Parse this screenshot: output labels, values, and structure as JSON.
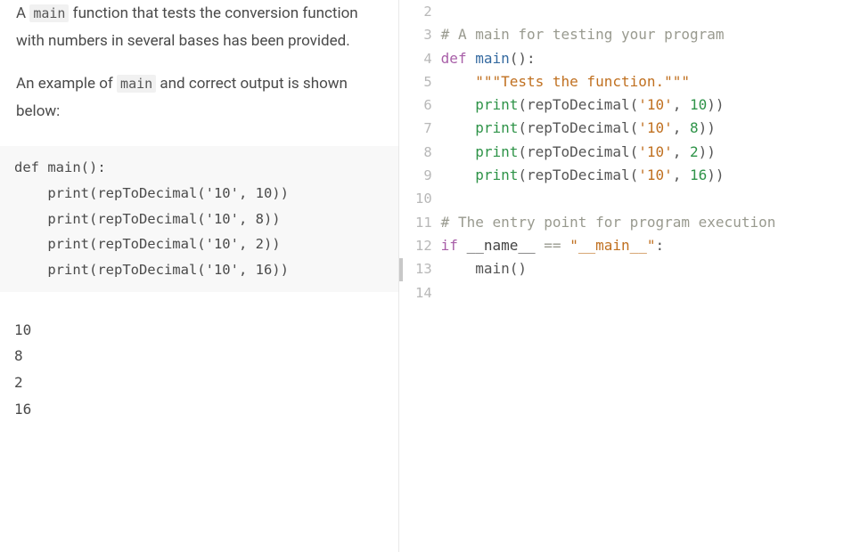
{
  "instructions": {
    "para1_a": "A ",
    "para1_code": "main",
    "para1_b": " function that tests the conversion function with numbers in several bases has been provided.",
    "para2_a": "An example of ",
    "para2_code": "main",
    "para2_b": " and correct output is shown below:"
  },
  "example_code": "def main():\n    print(repToDecimal('10', 10))\n    print(repToDecimal('10', 8))\n    print(repToDecimal('10', 2))\n    print(repToDecimal('10', 16))",
  "example_output": "10\n8\n2\n16",
  "editor": {
    "line_numbers": [
      "2",
      "3",
      "4",
      "5",
      "6",
      "7",
      "8",
      "9",
      "10",
      "11",
      "12",
      "13",
      "14"
    ],
    "lines": [
      {
        "tokens": [
          {
            "t": "",
            "c": ""
          }
        ]
      },
      {
        "tokens": [
          {
            "t": "# A main for testing your program",
            "c": "tok-comment"
          }
        ]
      },
      {
        "tokens": [
          {
            "t": "def ",
            "c": "tok-keyword"
          },
          {
            "t": "main",
            "c": "tok-def"
          },
          {
            "t": "():",
            "c": "tok-paren"
          }
        ]
      },
      {
        "tokens": [
          {
            "t": "    ",
            "c": ""
          },
          {
            "t": "\"\"\"Tests the function.\"\"\"",
            "c": "tok-str"
          }
        ]
      },
      {
        "tokens": [
          {
            "t": "    ",
            "c": ""
          },
          {
            "t": "print",
            "c": "tok-builtin"
          },
          {
            "t": "(repToDecimal(",
            "c": "tok-paren"
          },
          {
            "t": "'10'",
            "c": "tok-str"
          },
          {
            "t": ", ",
            "c": "tok-paren"
          },
          {
            "t": "10",
            "c": "tok-num"
          },
          {
            "t": "))",
            "c": "tok-paren"
          }
        ]
      },
      {
        "tokens": [
          {
            "t": "    ",
            "c": ""
          },
          {
            "t": "print",
            "c": "tok-builtin"
          },
          {
            "t": "(repToDecimal(",
            "c": "tok-paren"
          },
          {
            "t": "'10'",
            "c": "tok-str"
          },
          {
            "t": ", ",
            "c": "tok-paren"
          },
          {
            "t": "8",
            "c": "tok-num"
          },
          {
            "t": "))",
            "c": "tok-paren"
          }
        ]
      },
      {
        "tokens": [
          {
            "t": "    ",
            "c": ""
          },
          {
            "t": "print",
            "c": "tok-builtin"
          },
          {
            "t": "(repToDecimal(",
            "c": "tok-paren"
          },
          {
            "t": "'10'",
            "c": "tok-str"
          },
          {
            "t": ", ",
            "c": "tok-paren"
          },
          {
            "t": "2",
            "c": "tok-num"
          },
          {
            "t": "))",
            "c": "tok-paren"
          }
        ]
      },
      {
        "tokens": [
          {
            "t": "    ",
            "c": ""
          },
          {
            "t": "print",
            "c": "tok-builtin"
          },
          {
            "t": "(repToDecimal(",
            "c": "tok-paren"
          },
          {
            "t": "'10'",
            "c": "tok-str"
          },
          {
            "t": ", ",
            "c": "tok-paren"
          },
          {
            "t": "16",
            "c": "tok-num"
          },
          {
            "t": "))",
            "c": "tok-paren"
          }
        ]
      },
      {
        "tokens": [
          {
            "t": "",
            "c": ""
          }
        ]
      },
      {
        "tokens": [
          {
            "t": "# The entry point for program execution",
            "c": "tok-comment"
          }
        ]
      },
      {
        "tokens": [
          {
            "t": "if ",
            "c": "tok-keyword"
          },
          {
            "t": "__name__ ",
            "c": "tok-func"
          },
          {
            "t": "== ",
            "c": "tok-op"
          },
          {
            "t": "\"__main__\"",
            "c": "tok-str"
          },
          {
            "t": ":",
            "c": "tok-paren"
          }
        ]
      },
      {
        "tokens": [
          {
            "t": "    main()",
            "c": "tok-paren"
          }
        ]
      },
      {
        "tokens": [
          {
            "t": "",
            "c": ""
          }
        ]
      }
    ]
  }
}
